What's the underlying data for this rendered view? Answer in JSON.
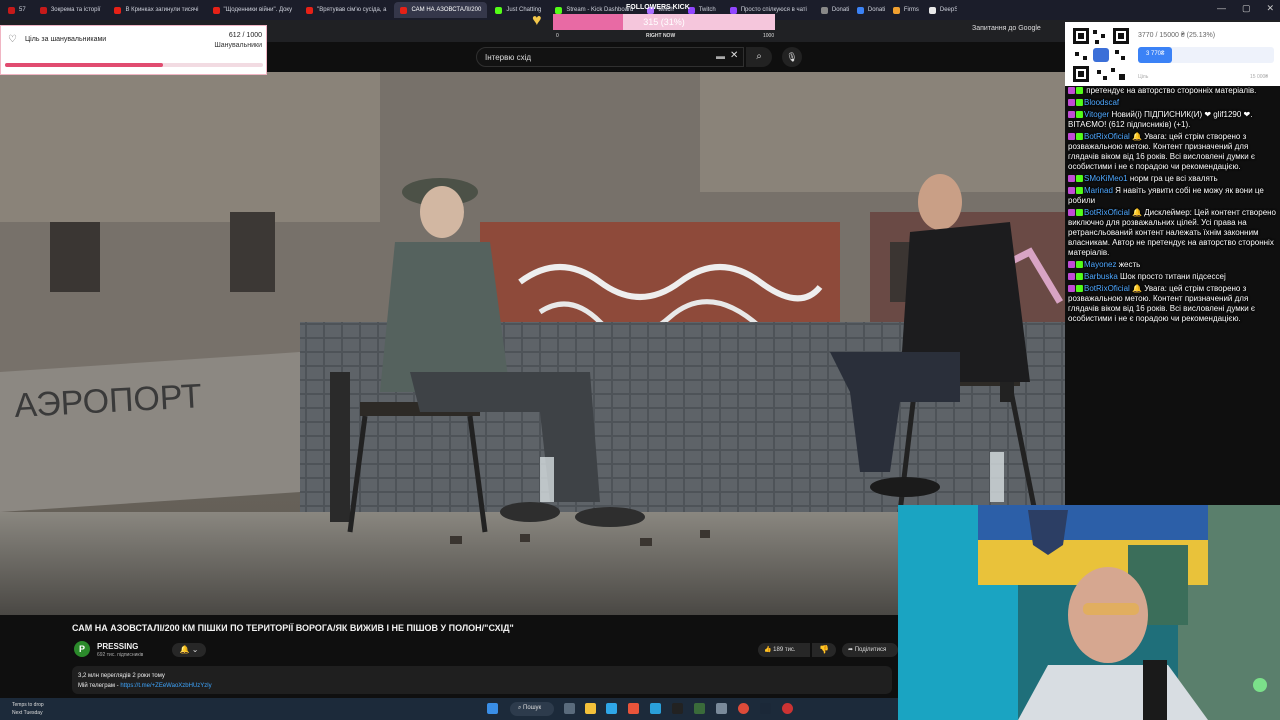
{
  "browser": {
    "tabs": [
      {
        "label": "57",
        "color": "#c61a1a"
      },
      {
        "label": "Зокрема та історії",
        "color": "#c61a1a"
      },
      {
        "label": "В Кринках загинули тисячі",
        "color": "#e62117"
      },
      {
        "label": "\"Щоденники війни\". Доку",
        "color": "#e62117"
      },
      {
        "label": "\"Врятував сім'ю сусіда, а",
        "color": "#e62117"
      },
      {
        "label": "САМ НА АЗОВСТАЛІ/200",
        "color": "#e62117",
        "active": true
      },
      {
        "label": "Just Chatting",
        "color": "#53fc18"
      },
      {
        "label": "Stream - Kick Dashboard",
        "color": "#53fc18"
      },
      {
        "label": "twitch",
        "color": "#a970ff"
      },
      {
        "label": "Twitch",
        "color": "#9146ff"
      },
      {
        "label": "Просто спілкуюся в чаті",
        "color": "#9146ff"
      },
      {
        "label": "Donatik",
        "color": "#888888"
      },
      {
        "label": "Donations",
        "color": "#3b82f6"
      },
      {
        "label": "Firms",
        "color": "#f0a030"
      },
      {
        "label": "DeepState",
        "color": "#e8e8e8"
      }
    ],
    "ask_google": "Запитання до Google"
  },
  "youtube": {
    "search_value": "Інтервю схід",
    "video_title": "САМ НА АЗОВСТАЛІ/200 КМ ПІШКИ ПО ТЕРИТОРІЇ ВОРОГА/ЯК ВИЖИВ І НЕ ПІШОВ У ПОЛОН/\"СХІД\"",
    "channel": "PRESSING",
    "subscribers": "692 тис. підписників",
    "likes": "189 тис.",
    "share": "Поділитися",
    "views_line": "3,2 млн переглядів  2 роки тому",
    "telegram_label": "Мій телеграм - ",
    "telegram_link": "https://t.me/+ZEeWaoXzbHUzYzly",
    "scene_wall_text": "АЭРОПОРТ"
  },
  "goal_widget": {
    "label": "Ціль за шанувальниками",
    "count": "612 / 1000",
    "sub": "Шанувальники",
    "progress": 0.612
  },
  "followers_kick": {
    "title": "FOLLOWERS KICK",
    "value": "315 (31%)",
    "progress": 0.315,
    "min": "0",
    "now": "RIGHT NOW",
    "max": "1000"
  },
  "donation": {
    "text": "3770 / 15000 ₴ (25.13%)",
    "amount": "3 770₴",
    "progress": 0.2513,
    "min": "Ціль",
    "max": "15 000₴"
  },
  "chat": [
    {
      "nick": "",
      "text": "претендує на авторство сторонніх матеріалів."
    },
    {
      "nick": "Bloodscaf",
      "text": ""
    },
    {
      "nick": "Vitoger",
      "text": "Новий(і) ПІДПИСНИК(И) ❤ glif1290 ❤. ВІТАЄМО! (612 підписників) (+1)."
    },
    {
      "nick": "BotRixOficial",
      "text": "🔔 Увага: цей стрім створено з розважальною метою. Контент призначений для глядачів віком від 16 років. Всі висловлені думки є особистими і не є порадою чи рекомендацією."
    },
    {
      "nick": "SMoKiMeo1",
      "text": "норм гра це всі хвалять"
    },
    {
      "nick": "Marinad",
      "text": "Я навіть уявити собі не можу як вони це робили"
    },
    {
      "nick": "BotRixOficial",
      "text": "🔔 Дисклеймер: Цей контент створено виключно для розважальних цілей. Усі права на ретрансльований контент належать їхнім законним власникам. Автор не претендує на авторство сторонніх матеріалів."
    },
    {
      "nick": "Mayonez",
      "text": "жесть"
    },
    {
      "nick": "Barbuska",
      "text": "Шок просто титани підсессеj"
    },
    {
      "nick": "BotRixOficial",
      "text": "🔔 Увага: цей стрім створено з розважальною метою. Контент призначений для глядачів віком від 16 років. Всі висловлені думки є особистими і не є порадою чи рекомендацією."
    }
  ],
  "taskbar": {
    "weather": "Temps to drop",
    "weather_sub": "Next Tuesday",
    "search": "Пошук"
  },
  "colors": {
    "youtube_red": "#ff0000",
    "kick_green": "#53fc18",
    "accent_pink": "#e14c70",
    "accent_blue": "#3b82f6"
  }
}
